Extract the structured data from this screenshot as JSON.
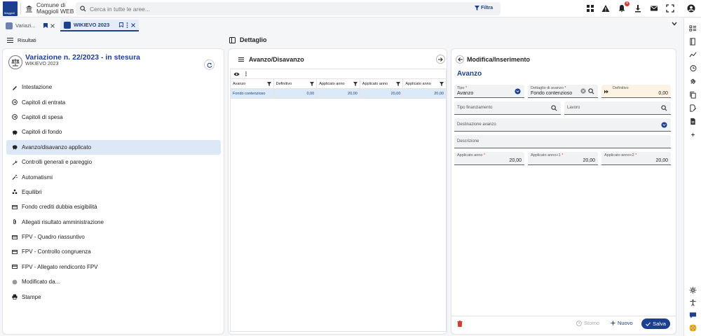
{
  "topbar": {
    "logo_text": "Maggioli",
    "app_title_line1": "Comune di",
    "app_title_line2": "Maggioli WEB",
    "search_placeholder": "Cerca in tutte le aree...",
    "filter_label": "Filtra",
    "notification_count": "4",
    "icons": [
      "apps-icon",
      "alert-icon",
      "bell-icon",
      "download-icon",
      "mail-icon",
      "fullscreen-icon",
      "account-icon"
    ]
  },
  "tabs": [
    {
      "label": "Variazi...",
      "active": false
    },
    {
      "label": "WIKIEVO 2023",
      "active": true
    }
  ],
  "left": {
    "toolbar_label": "Risultati",
    "title": "Variazione n. 22/2023 - in stesura",
    "subtitle": "WIKIEVO 2023",
    "menu": [
      {
        "label": "Intestazione",
        "icon": "pencil-icon"
      },
      {
        "label": "Capitoli di entrata",
        "icon": "arrow-circle-icon"
      },
      {
        "label": "Capitoli di spesa",
        "icon": "arrow-circle-icon"
      },
      {
        "label": "Capitoli di fondo",
        "icon": "piggy-icon"
      },
      {
        "label": "Avanzo/disavanzo applicato",
        "icon": "piggy-icon",
        "active": true
      },
      {
        "label": "Controlli generali e pareggio",
        "icon": "wrench-icon"
      },
      {
        "label": "Automatismi",
        "icon": "wand-icon"
      },
      {
        "label": "Equilibri",
        "icon": "boxes-icon"
      },
      {
        "label": "Fondo crediti dubbia esigibilità",
        "icon": "card-icon"
      },
      {
        "label": "Allegati risultato amministrazione",
        "icon": "clip-icon"
      },
      {
        "label": "FPV - Quadro riassuntivo",
        "icon": "card-icon"
      },
      {
        "label": "FPV - Controllo congruenza",
        "icon": "card-icon"
      },
      {
        "label": "FPV - Allegato rendiconto FPV",
        "icon": "card-icon"
      },
      {
        "label": "Modificato da...",
        "icon": "stamp-icon"
      },
      {
        "label": "Stampe",
        "icon": "printer-icon"
      }
    ]
  },
  "detail": {
    "title": "Dettaglio"
  },
  "grid": {
    "title": "Avanzo/Disavanzo",
    "columns": [
      "Avanzo",
      "Definitivo",
      "Applicato anno",
      "Applicato anno",
      "Applicato anno"
    ],
    "rows": [
      [
        "Fondo contenzioso",
        "0,00",
        "20,00",
        "20,00",
        "20,00"
      ]
    ]
  },
  "form": {
    "panel_title": "Modifica/Inserimento",
    "section_title": "Avanzo",
    "tipo": {
      "label": "Tipo",
      "value": "Avanzo"
    },
    "dettaglio": {
      "label": "Dettaglio di avanzo",
      "value": "Fondo contenzioso"
    },
    "definitivo": {
      "label": "Definitivo",
      "value": "0,00"
    },
    "tipo_finanziamento": {
      "label": "Tipo finanziamento"
    },
    "lavoro": {
      "label": "Lavoro"
    },
    "destinazione": {
      "label": "Destinazione avanzo"
    },
    "descrizione": {
      "label": "Descrizione"
    },
    "anno": {
      "label": "Applicato anno",
      "value": "20,00"
    },
    "anno1": {
      "label": "Applicato anno+1",
      "value": "20,00"
    },
    "anno2": {
      "label": "Applicato anno+2",
      "value": "20,00"
    },
    "buttons": {
      "storno": "Storno",
      "nuovo": "Nuovo",
      "salva": "Salva"
    }
  },
  "colors": {
    "brand": "#1d3f8f",
    "active_row": "#dce9f8",
    "required": "#d23b2f",
    "definitivo_bg": "#fcf3e2"
  }
}
